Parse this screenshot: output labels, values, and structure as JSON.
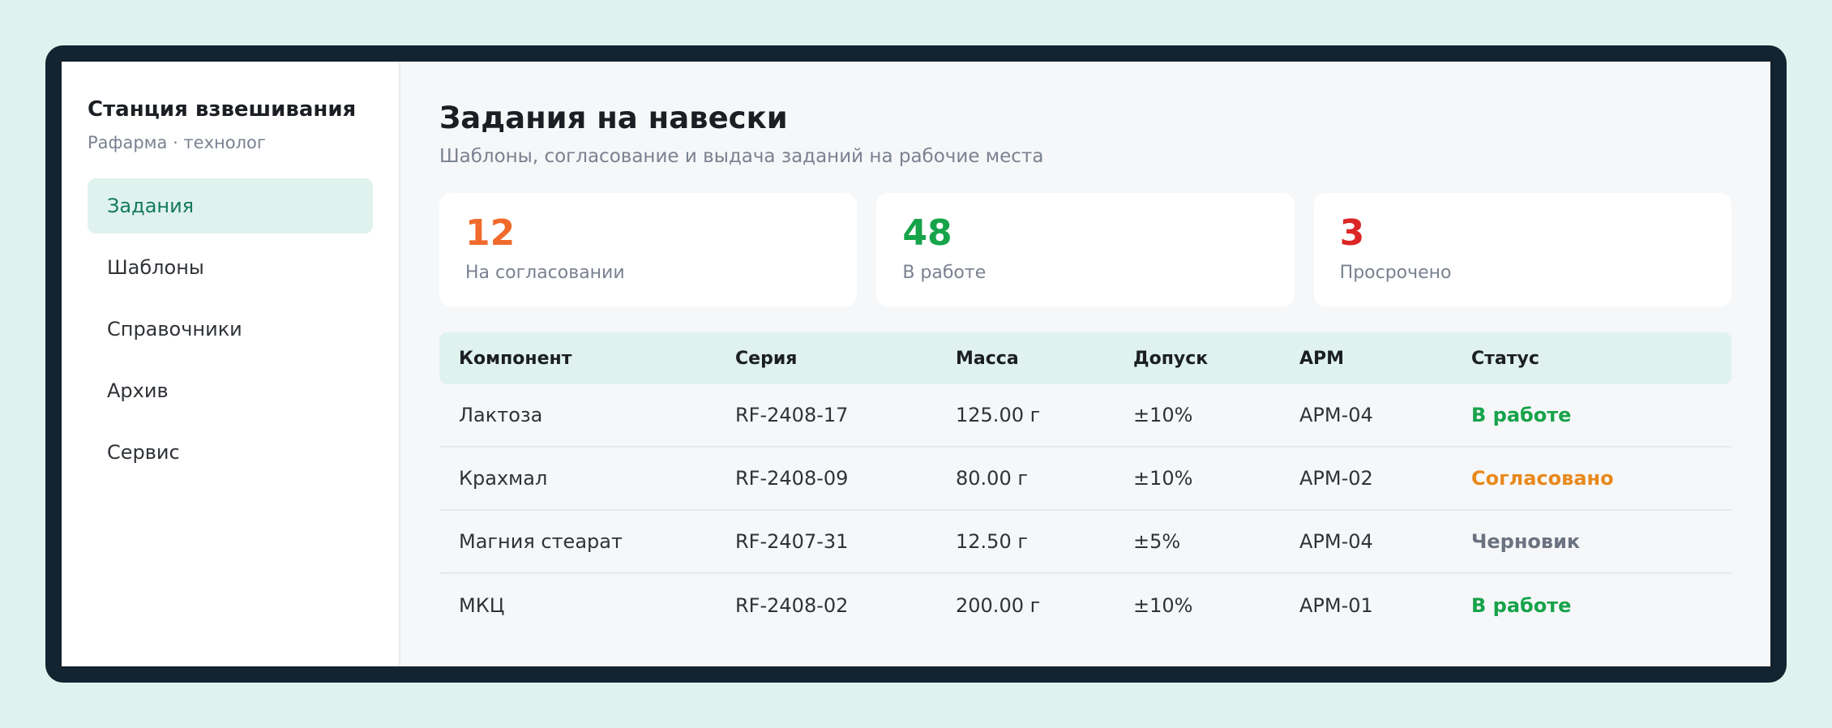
{
  "sidebar": {
    "app_title": "Станция взвешивания",
    "app_subtitle": "Рафарма · технолог",
    "items": [
      {
        "label": "Задания",
        "active": true
      },
      {
        "label": "Шаблоны",
        "active": false
      },
      {
        "label": "Справочники",
        "active": false
      },
      {
        "label": "Архив",
        "active": false
      },
      {
        "label": "Сервис",
        "active": false
      }
    ]
  },
  "header": {
    "title": "Задания на навески",
    "subtitle": "Шаблоны, согласование и выдача заданий на рабочие места"
  },
  "stats": [
    {
      "value": "12",
      "label": "На согласовании",
      "color": "#f06a2c"
    },
    {
      "value": "48",
      "label": "В работе",
      "color": "#16a34a"
    },
    {
      "value": "3",
      "label": "Просрочено",
      "color": "#dc2626"
    }
  ],
  "table": {
    "columns": [
      "Компонент",
      "Серия",
      "Масса",
      "Допуск",
      "АРМ",
      "Статус"
    ],
    "rows": [
      {
        "component": "Лактоза",
        "series": "RF-2408-17",
        "mass": "125.00 г",
        "tolerance": "±10%",
        "station": "АРМ-04",
        "status": "В работе",
        "status_color": "#16a34a"
      },
      {
        "component": "Крахмал",
        "series": "RF-2408-09",
        "mass": "80.00 г",
        "tolerance": "±10%",
        "station": "АРМ-02",
        "status": "Согласовано",
        "status_color": "#e8891c"
      },
      {
        "component": "Магния стеарат",
        "series": "RF-2407-31",
        "mass": "12.50 г",
        "tolerance": "±5%",
        "station": "АРМ-04",
        "status": "Черновик",
        "status_color": "#6b7280"
      },
      {
        "component": "МКЦ",
        "series": "RF-2408-02",
        "mass": "200.00 г",
        "tolerance": "±10%",
        "station": "АРМ-01",
        "status": "В работе",
        "status_color": "#16a34a"
      }
    ]
  }
}
